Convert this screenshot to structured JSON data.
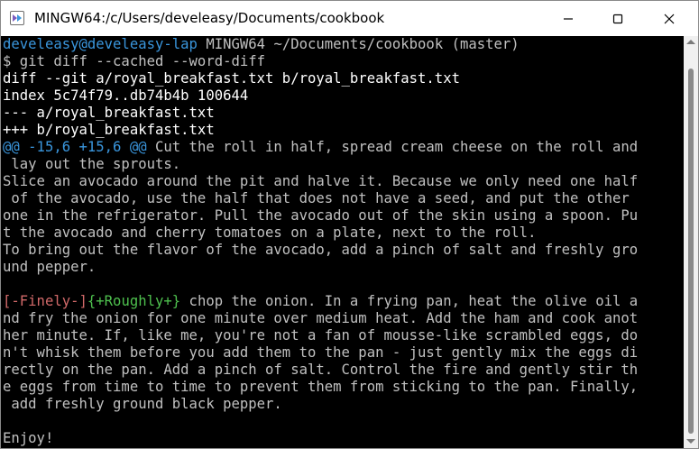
{
  "window": {
    "title": "MINGW64:/c/Users/develeasy/Documents/cookbook",
    "icon": "mingw-app-icon",
    "controls": [
      "minimize-icon",
      "maximize-icon",
      "close-icon"
    ]
  },
  "colors": {
    "background": "#000000",
    "text": "#c0c0c0",
    "prompt": "#3a96dd",
    "hunk_header": "#3a96dd",
    "deleted": "#d16969",
    "added": "#4ec04e"
  },
  "terminal": {
    "prompt": {
      "user_host": "develeasy@develeasy-lap",
      "system": "MINGW64",
      "path": "~/Documents/cookbook",
      "branch": "(master)"
    },
    "command": "$ git diff --cached --word-diff",
    "diff_header": "diff --git a/royal_breakfast.txt b/royal_breakfast.txt",
    "index_line": "index 5c74f79..db74b4b 100644",
    "old_file": "--- a/royal_breakfast.txt",
    "new_file": "+++ b/royal_breakfast.txt",
    "hunk": {
      "header": "@@ -15,6 +15,6 @@",
      "context_start": " Cut the roll in half, spread cream cheese on the roll and",
      "context_cont": " lay out the sprouts."
    },
    "avocado_lines": [
      "Slice an avocado around the pit and halve it. Because we only need one half",
      " of the avocado, use the half that does not have a seed, and put the other",
      "one in the refrigerator. Pull the avocado out of the skin using a spoon. Pu",
      "t the avocado and cherry tomatoes on a plate, next to the roll."
    ],
    "flavor_lines": [
      "To bring out the flavor of the avocado, add a pinch of salt and freshly gro",
      "und pepper."
    ],
    "word_diff": {
      "deleted": "[-Finely-]",
      "added": "{+Roughly+}",
      "rest": " chop the onion. In a frying pan, heat the olive oil a"
    },
    "onion_lines": [
      "nd fry the onion for one minute over medium heat. Add the ham and cook anot",
      "her minute. If, like me, you're not a fan of mousse-like scrambled eggs, do",
      "n't whisk them before you add them to the pan - just gently mix the eggs di",
      "rectly on the pan. Add a pinch of salt. Control the fire and gently stir th",
      "e eggs from time to time to prevent them from sticking to the pan. Finally,",
      " add freshly ground black pepper."
    ],
    "closing": "Enjoy!"
  }
}
